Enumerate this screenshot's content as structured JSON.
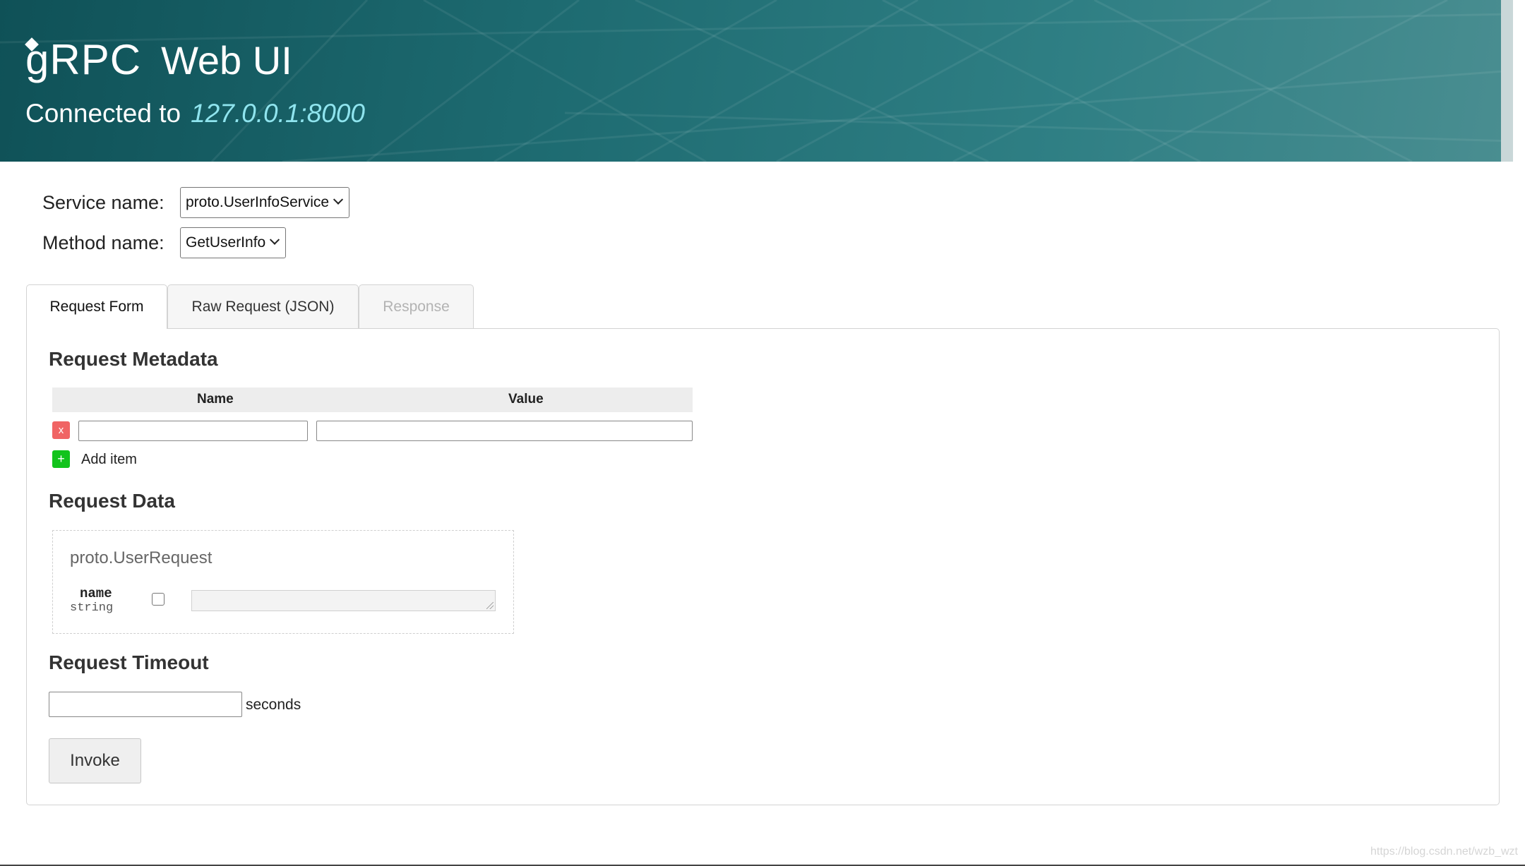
{
  "header": {
    "logo_text": "gRPC",
    "app_title": "Web UI",
    "connected_label": "Connected to",
    "connected_address": "127.0.0.1:8000"
  },
  "selectors": {
    "service_label": "Service name:",
    "service_value": "proto.UserInfoService",
    "method_label": "Method name:",
    "method_value": "GetUserInfo"
  },
  "tabs": [
    {
      "label": "Request Form",
      "state": "active"
    },
    {
      "label": "Raw Request (JSON)",
      "state": "normal"
    },
    {
      "label": "Response",
      "state": "disabled"
    }
  ],
  "metadata": {
    "title": "Request Metadata",
    "col_name": "Name",
    "col_value": "Value",
    "remove_symbol": "x",
    "add_symbol": "+",
    "add_label": "Add item"
  },
  "request_data": {
    "title": "Request Data",
    "message_type": "proto.UserRequest",
    "field_name": "name",
    "field_type": "string"
  },
  "timeout": {
    "title": "Request Timeout",
    "unit": "seconds"
  },
  "invoke_label": "Invoke",
  "watermark": "https://blog.csdn.net/wzb_wzt",
  "colors": {
    "header_bg": "#1d6a70",
    "address_color": "#8fe4ee",
    "remove_btn": "#f06464",
    "add_btn": "#12c31c"
  }
}
